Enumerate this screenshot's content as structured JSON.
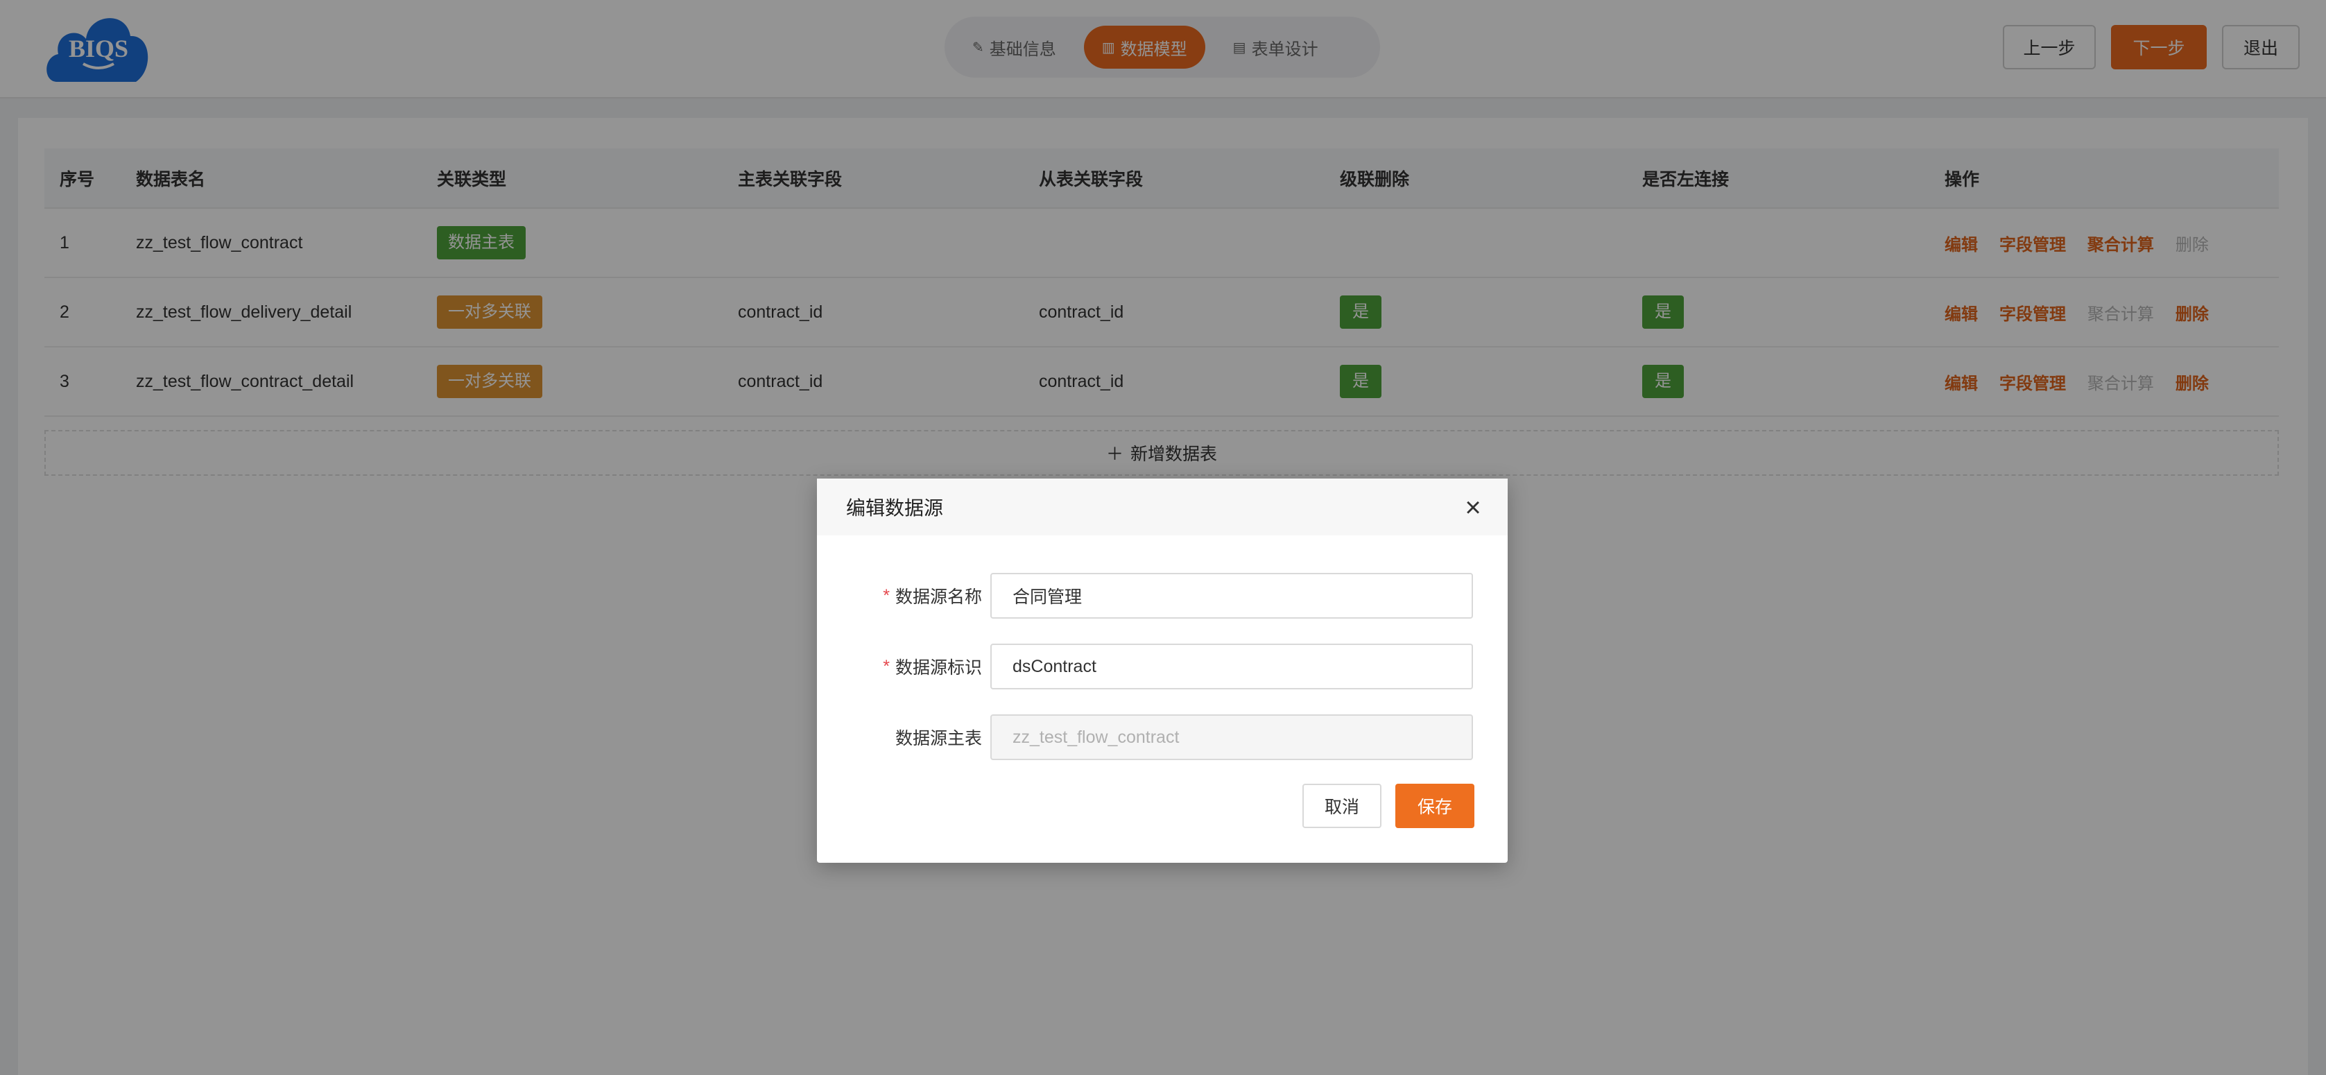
{
  "logo": {
    "text": "BIQS"
  },
  "steps": [
    {
      "label": "基础信息",
      "icon": "document-edit-icon",
      "active": false
    },
    {
      "label": "数据模型",
      "icon": "bar-chart-icon",
      "active": true
    },
    {
      "label": "表单设计",
      "icon": "form-icon",
      "active": false
    }
  ],
  "header_buttons": {
    "prev": "上一步",
    "next": "下一步",
    "exit": "退出"
  },
  "table": {
    "headers": [
      "序号",
      "数据表名",
      "关联类型",
      "主表关联字段",
      "从表关联字段",
      "级联删除",
      "是否左连接",
      "操作"
    ],
    "rows": [
      {
        "index": "1",
        "name": "zz_test_flow_contract",
        "type": "数据主表",
        "main_field": "",
        "sub_field": "",
        "cascade": "",
        "left_join": ""
      },
      {
        "index": "2",
        "name": "zz_test_flow_delivery_detail",
        "type": "一对多关联",
        "main_field": "contract_id",
        "sub_field": "contract_id",
        "cascade": "是",
        "left_join": "是"
      },
      {
        "index": "3",
        "name": "zz_test_flow_contract_detail",
        "type": "一对多关联",
        "main_field": "contract_id",
        "sub_field": "contract_id",
        "cascade": "是",
        "left_join": "是"
      }
    ],
    "ops": {
      "edit": "编辑",
      "fields": "字段管理",
      "aggregate": "聚合计算",
      "delete": "删除"
    }
  },
  "add_row_label": "新增数据表",
  "modal": {
    "title": "编辑数据源",
    "fields": [
      {
        "label": "数据源名称",
        "required": true,
        "value": "合同管理",
        "disabled": false
      },
      {
        "label": "数据源标识",
        "required": true,
        "value": "dsContract",
        "disabled": false
      },
      {
        "label": "数据源主表",
        "required": false,
        "value": "zz_test_flow_contract",
        "disabled": true
      }
    ],
    "cancel": "取消",
    "save": "保存"
  },
  "colors": {
    "accent": "#ea6a1f",
    "tag_green": "#4fa33b",
    "tag_orange": "#dd9332"
  }
}
